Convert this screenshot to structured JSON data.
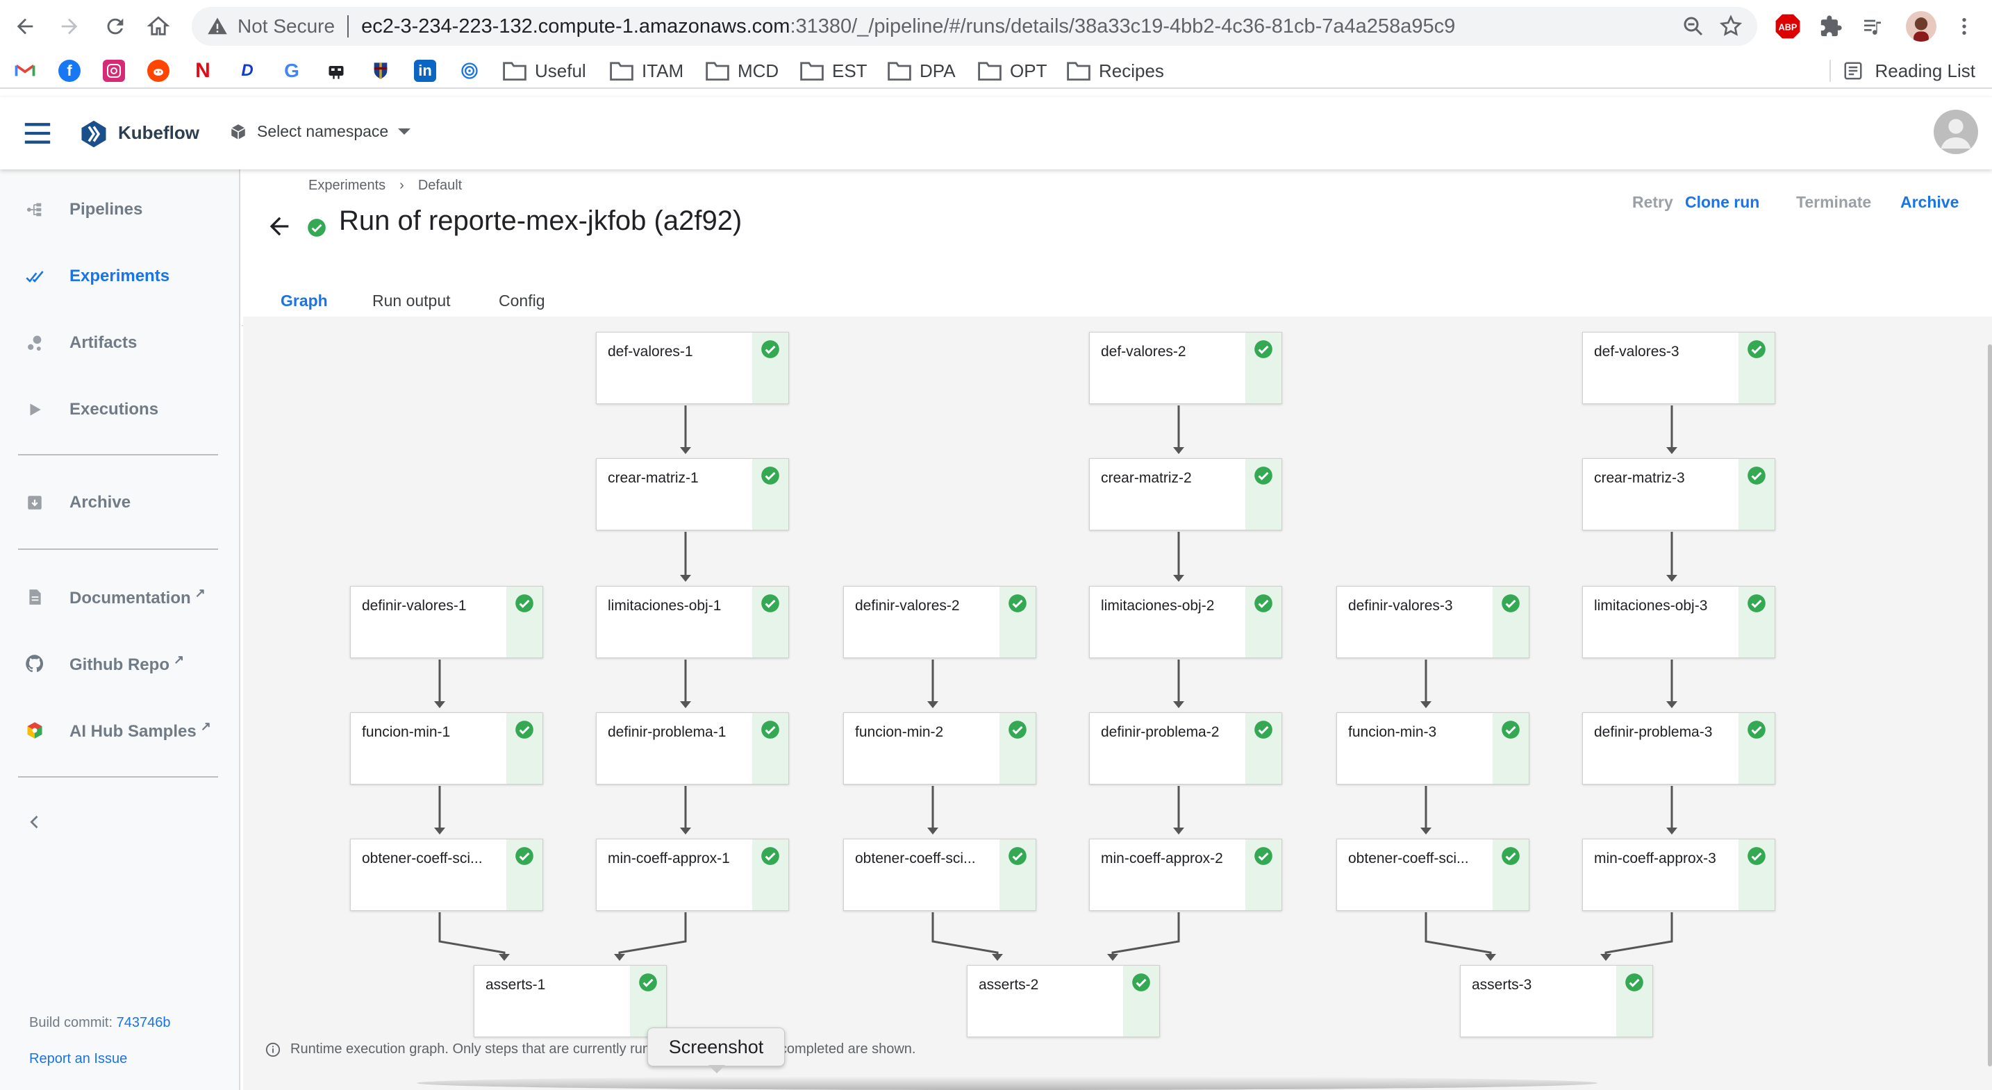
{
  "browser": {
    "insecure_label": "Not Secure",
    "url_host": "ec2-3-234-223-132.compute-1.amazonaws.com",
    "url_rest": ":31380/_/pipeline/#/runs/details/38a33c19-4bb2-4c36-81cb-7a4a258a95c9",
    "bookmarks": {
      "folders": [
        "Useful",
        "ITAM",
        "MCD",
        "EST",
        "DPA",
        "OPT",
        "Recipes"
      ],
      "reading_list": "Reading List"
    }
  },
  "kf": {
    "title": "Kubeflow",
    "namespace_placeholder": "Select namespace"
  },
  "sidenav": {
    "items": [
      {
        "label": "Pipelines"
      },
      {
        "label": "Experiments"
      },
      {
        "label": "Artifacts"
      },
      {
        "label": "Executions"
      },
      {
        "label": "Archive"
      },
      {
        "label": "Documentation"
      },
      {
        "label": "Github Repo"
      },
      {
        "label": "AI Hub Samples"
      }
    ],
    "build_commit_label": "Build commit:",
    "build_commit_hash": "743746b",
    "report_issue": "Report an Issue"
  },
  "header": {
    "breadcrumb": [
      "Experiments",
      "Default"
    ],
    "run_title": "Run of reporte-mex-jkfob (a2f92)",
    "actions": {
      "retry": "Retry",
      "clone": "Clone run",
      "terminate": "Terminate",
      "archive": "Archive"
    },
    "tabs": [
      "Graph",
      "Run output",
      "Config"
    ]
  },
  "graph": {
    "nodes": [
      {
        "id": "def-valores-1",
        "label": "def-valores-1",
        "status": "succeeded"
      },
      {
        "id": "crear-matriz-1",
        "label": "crear-matriz-1",
        "status": "succeeded"
      },
      {
        "id": "limitaciones-obj-1",
        "label": "limitaciones-obj-1",
        "status": "succeeded"
      },
      {
        "id": "definir-problema-1",
        "label": "definir-problema-1",
        "status": "succeeded"
      },
      {
        "id": "min-coeff-approx-1",
        "label": "min-coeff-approx-1",
        "status": "succeeded"
      },
      {
        "id": "definir-valores-1",
        "label": "definir-valores-1",
        "status": "succeeded"
      },
      {
        "id": "funcion-min-1",
        "label": "funcion-min-1",
        "status": "succeeded"
      },
      {
        "id": "obtener-coeff-sci-1",
        "label": "obtener-coeff-sci...",
        "status": "succeeded"
      },
      {
        "id": "asserts-1",
        "label": "asserts-1",
        "status": "succeeded"
      },
      {
        "id": "def-valores-2",
        "label": "def-valores-2",
        "status": "succeeded"
      },
      {
        "id": "crear-matriz-2",
        "label": "crear-matriz-2",
        "status": "succeeded"
      },
      {
        "id": "limitaciones-obj-2",
        "label": "limitaciones-obj-2",
        "status": "succeeded"
      },
      {
        "id": "definir-problema-2",
        "label": "definir-problema-2",
        "status": "succeeded"
      },
      {
        "id": "min-coeff-approx-2",
        "label": "min-coeff-approx-2",
        "status": "succeeded"
      },
      {
        "id": "definir-valores-2",
        "label": "definir-valores-2",
        "status": "succeeded"
      },
      {
        "id": "funcion-min-2",
        "label": "funcion-min-2",
        "status": "succeeded"
      },
      {
        "id": "obtener-coeff-sci-2",
        "label": "obtener-coeff-sci...",
        "status": "succeeded"
      },
      {
        "id": "asserts-2",
        "label": "asserts-2",
        "status": "succeeded"
      },
      {
        "id": "def-valores-3",
        "label": "def-valores-3",
        "status": "succeeded"
      },
      {
        "id": "crear-matriz-3",
        "label": "crear-matriz-3",
        "status": "succeeded"
      },
      {
        "id": "limitaciones-obj-3",
        "label": "limitaciones-obj-3",
        "status": "succeeded"
      },
      {
        "id": "definir-problema-3",
        "label": "definir-problema-3",
        "status": "succeeded"
      },
      {
        "id": "min-coeff-approx-3",
        "label": "min-coeff-approx-3",
        "status": "succeeded"
      },
      {
        "id": "definir-valores-3",
        "label": "definir-valores-3",
        "status": "succeeded"
      },
      {
        "id": "funcion-min-3",
        "label": "funcion-min-3",
        "status": "succeeded"
      },
      {
        "id": "obtener-coeff-sci-3",
        "label": "obtener-coeff-sci...",
        "status": "succeeded"
      },
      {
        "id": "asserts-3",
        "label": "asserts-3",
        "status": "succeeded"
      }
    ],
    "edges": [
      [
        "def-valores-1",
        "crear-matriz-1"
      ],
      [
        "crear-matriz-1",
        "limitaciones-obj-1"
      ],
      [
        "limitaciones-obj-1",
        "definir-problema-1"
      ],
      [
        "definir-problema-1",
        "min-coeff-approx-1"
      ],
      [
        "definir-valores-1",
        "funcion-min-1"
      ],
      [
        "funcion-min-1",
        "obtener-coeff-sci-1"
      ],
      [
        "obtener-coeff-sci-1",
        "asserts-1"
      ],
      [
        "min-coeff-approx-1",
        "asserts-1"
      ],
      [
        "def-valores-2",
        "crear-matriz-2"
      ],
      [
        "crear-matriz-2",
        "limitaciones-obj-2"
      ],
      [
        "limitaciones-obj-2",
        "definir-problema-2"
      ],
      [
        "definir-problema-2",
        "min-coeff-approx-2"
      ],
      [
        "definir-valores-2",
        "funcion-min-2"
      ],
      [
        "funcion-min-2",
        "obtener-coeff-sci-2"
      ],
      [
        "obtener-coeff-sci-2",
        "asserts-2"
      ],
      [
        "min-coeff-approx-2",
        "asserts-2"
      ],
      [
        "def-valores-3",
        "crear-matriz-3"
      ],
      [
        "crear-matriz-3",
        "limitaciones-obj-3"
      ],
      [
        "limitaciones-obj-3",
        "definir-problema-3"
      ],
      [
        "definir-problema-3",
        "min-coeff-approx-3"
      ],
      [
        "definir-valores-3",
        "funcion-min-3"
      ],
      [
        "funcion-min-3",
        "obtener-coeff-sci-3"
      ],
      [
        "obtener-coeff-sci-3",
        "asserts-3"
      ],
      [
        "min-coeff-approx-3",
        "asserts-3"
      ]
    ],
    "note": "Runtime execution graph. Only steps that are currently running or have already completed are shown."
  },
  "tooltip": "Screenshot",
  "colors": {
    "accent": "#1a73e8",
    "success": "#34a853",
    "success_bg": "#e6f4ea",
    "edge": "#555555"
  }
}
